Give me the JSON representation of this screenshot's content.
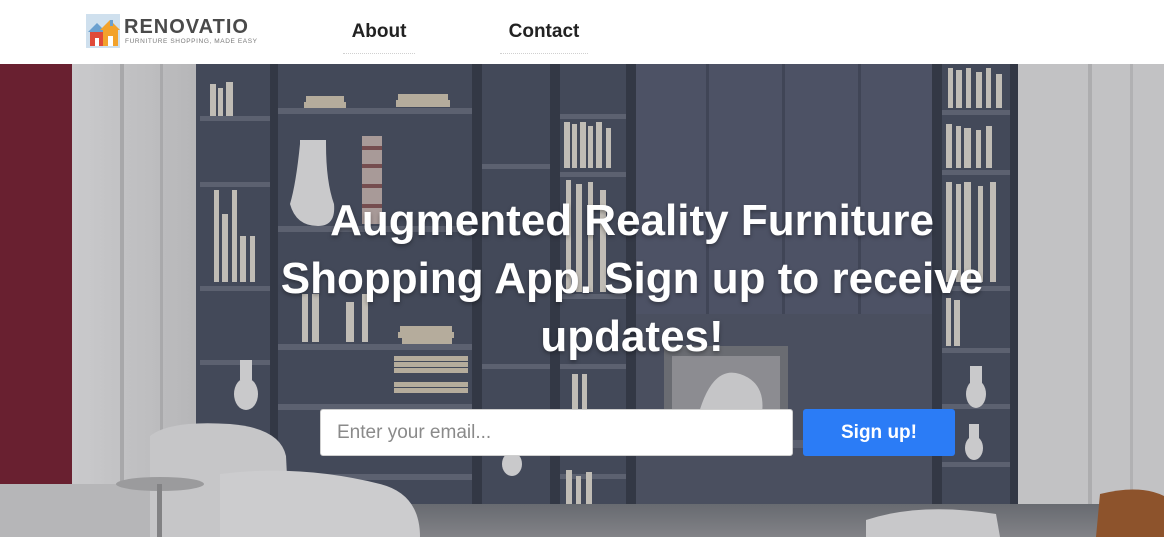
{
  "brand": {
    "name": "RENOVATIO",
    "tagline": "FURNITURE SHOPPING, MADE EASY",
    "logo_icon": "house-icon"
  },
  "nav": {
    "items": [
      {
        "label": "About"
      },
      {
        "label": "Contact"
      }
    ]
  },
  "hero": {
    "headline": "Augmented Reality Furniture Shopping App. Sign up to receive updates!",
    "background": "living-room-bookshelf-photo",
    "email": {
      "placeholder": "Enter your email...",
      "value": ""
    },
    "signup_label": "Sign up!"
  },
  "colors": {
    "accent": "#2b7cf6",
    "header_bg": "#ffffff",
    "headline": "#ffffff"
  }
}
